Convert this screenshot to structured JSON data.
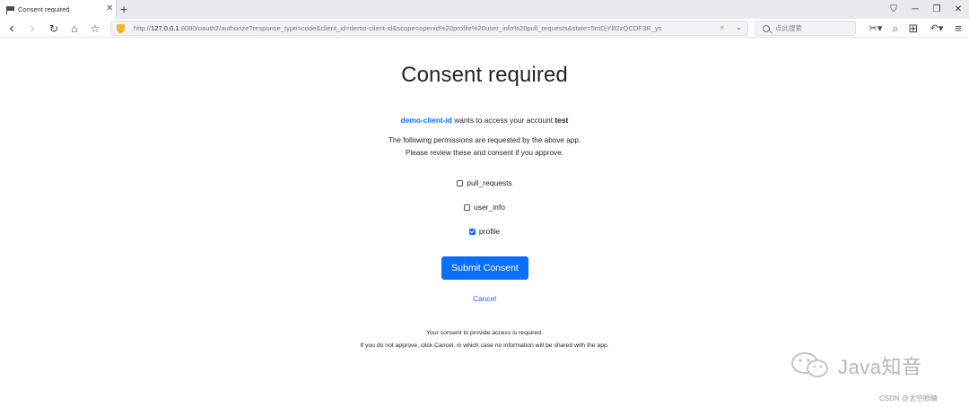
{
  "browser": {
    "tab": {
      "title": "Consent required",
      "close_glyph": "✕",
      "favicon": "flag-icon"
    },
    "new_tab_glyph": "+",
    "window_controls": [
      "⛉",
      "─",
      "❐",
      "✕"
    ],
    "nav": {
      "back": "‹",
      "forward": "›",
      "reload": "↻",
      "home": "⌂",
      "bookmark": "☆"
    },
    "address": {
      "scheme": "http://",
      "host": "127.0.0.1",
      "rest": ":8080/oauth2/authorize?response_type=code&client_id=demo-client-id&scope=openid%20profile%20user_info%20pull_requests&state=5mDjYlll2zQCDF3R_ys",
      "bolt": "⚡",
      "dropdown": "⌄"
    },
    "search": {
      "placeholder": "点此搜索"
    },
    "tools": {
      "cut": "✂▾",
      "zoom": "⌕",
      "grid": "⊞",
      "undo": "↶▾",
      "menu": "≡"
    }
  },
  "consent": {
    "title": "Consent required",
    "client_id": "demo-client-id",
    "wants_access_text": " wants to access your account ",
    "account": "test",
    "permissions_line1": "The following permissions are requested by the above app.",
    "permissions_line2": "Please review these and consent if you approve.",
    "scopes": [
      {
        "label": "pull_requests",
        "checked": false
      },
      {
        "label": "user_info",
        "checked": false
      },
      {
        "label": "profile",
        "checked": true
      }
    ],
    "submit_label": "Submit Consent",
    "cancel_label": "Cancel",
    "footer_line1": "Your consent to provide access is required.",
    "footer_line2": "If you do not approve, click Cancel, in which case no information will be shared with the app."
  },
  "watermark": {
    "channel": "Java知音",
    "csdn": "CSDN @太空眼睛"
  },
  "colors": {
    "accent": "#0d6efd",
    "tab_strip": "#e9eaed"
  }
}
